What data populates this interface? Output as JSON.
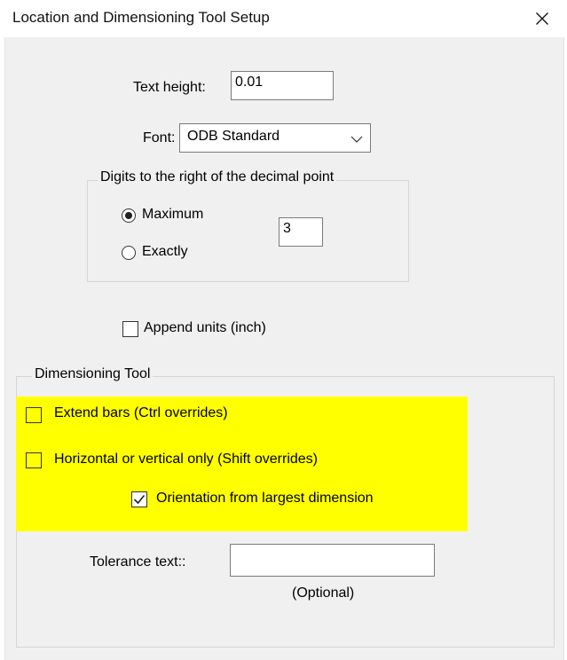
{
  "window": {
    "title": "Location and Dimensioning Tool Setup",
    "close_icon": "close-icon"
  },
  "text_height": {
    "label": "Text height:",
    "value": "0.01"
  },
  "font": {
    "label": "Font:",
    "selected": "ODB Standard"
  },
  "digits_group": {
    "title": "Digits to the right of the decimal point",
    "options": [
      {
        "label": "Maximum",
        "selected": true
      },
      {
        "label": "Exactly",
        "selected": false
      }
    ],
    "value": "3"
  },
  "append_units": {
    "label": "Append units (inch)",
    "checked": false
  },
  "dimensioning_tool": {
    "title": "Dimensioning Tool",
    "highlight_color": "#ffff00",
    "options": [
      {
        "label": "Extend bars (Ctrl overrides)",
        "checked": false
      },
      {
        "label": "Horizontal or vertical only (Shift overrides)",
        "checked": false
      },
      {
        "label": "Orientation from largest dimension",
        "checked": true
      }
    ],
    "tolerance": {
      "label": "Tolerance text::",
      "value": "",
      "hint": "(Optional)"
    }
  }
}
